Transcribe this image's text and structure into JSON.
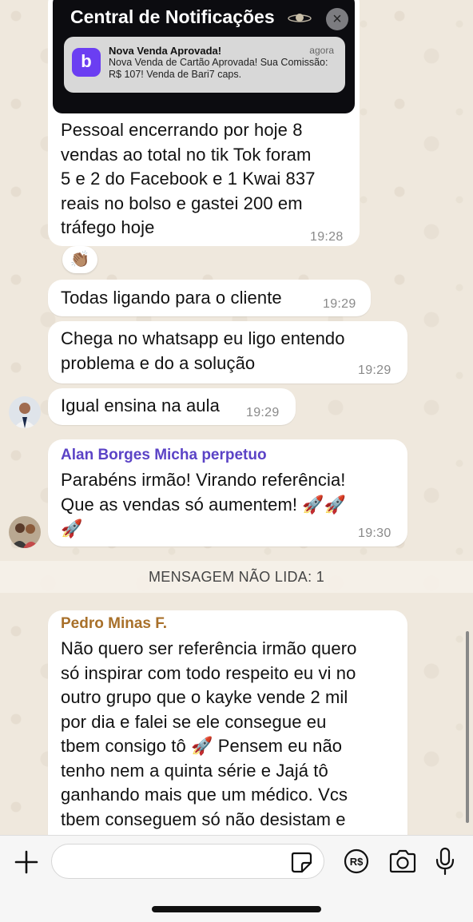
{
  "notification_image": {
    "title": "Central de Notificações",
    "app_letter": "b",
    "heading": "Nova Venda Aprovada!",
    "time": "agora",
    "body": "Nova Venda de Cartão Aprovada! Sua Comissão: R$ 107! Venda de Bari7 caps."
  },
  "messages": [
    {
      "text": "Pessoal encerrando por hoje 8\nvendas ao total no tik Tok foram\n5 e 2 do Facebook e 1 Kwai  837\nreais no bolso e gastei 200 em\ntráfego hoje",
      "time": "19:28",
      "reaction": "👏🏽"
    },
    {
      "text": "Todas ligando para o cliente",
      "time": "19:29"
    },
    {
      "text": "Chega no whatsapp eu ligo entendo\nproblema e do a solução",
      "time": "19:29"
    },
    {
      "text": "Igual ensina na aula",
      "time": "19:29"
    },
    {
      "sender": "Alan Borges Micha perpetuo",
      "sender_color": "#5b43c6",
      "text": "Parabéns irmão! Virando referência!\nQue as vendas só aumentem! 🚀🚀\n🚀",
      "time": "19:30"
    },
    {
      "sender": "Pedro Minas F.",
      "sender_color": "#a8702a",
      "text": "Não quero ser referência irmão quero\nsó inspirar com todo respeito eu vi no\noutro grupo que o kayke vende 2 mil\npor dia e falei se ele consegue eu\ntbem consigo tô 🚀 Pensem eu não\ntenho nem a quinta série e Jajá tô\nganhando mais que um médico. Vcs\ntbem conseguem só não desistam e"
    }
  ],
  "unread_divider": "MENSAGEM NÃO LIDA: 1",
  "composer": {
    "placeholder": "",
    "icons": [
      "plus-icon",
      "sticker-icon",
      "payment-icon",
      "camera-icon",
      "microphone-icon"
    ]
  }
}
